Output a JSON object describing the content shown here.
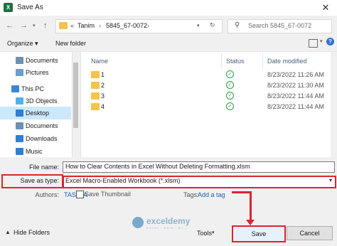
{
  "window": {
    "title": "Save As",
    "app_icon_letter": "X"
  },
  "nav": {
    "back": "←",
    "forward": "→",
    "up": "↑",
    "breadcrumb": [
      "Tanim",
      "5845_67-0072"
    ],
    "crumb_prefix": "«",
    "search_placeholder": "Search 5845_67-0072"
  },
  "toolbar": {
    "organize": "Organize ▾",
    "new_folder": "New folder"
  },
  "sidebar": {
    "items": [
      {
        "label": "Documents",
        "icon": "documents-icon",
        "color": "#6f8fb3"
      },
      {
        "label": "Pictures",
        "icon": "pictures-icon",
        "color": "#6a9fd4"
      },
      {
        "label": "This PC",
        "icon": "computer-icon",
        "color": "#3a86d6"
      },
      {
        "label": "3D Objects",
        "icon": "3d-objects-icon",
        "color": "#4fb3e8"
      },
      {
        "label": "Desktop",
        "icon": "desktop-icon",
        "color": "#2f7ed8"
      },
      {
        "label": "Documents",
        "icon": "documents-icon",
        "color": "#6f8fb3"
      },
      {
        "label": "Downloads",
        "icon": "downloads-icon",
        "color": "#2f7ed8"
      },
      {
        "label": "Music",
        "icon": "music-icon",
        "color": "#2f7ed8"
      }
    ]
  },
  "filelist": {
    "columns": {
      "name": "Name",
      "status": "Status",
      "date": "Date modified"
    },
    "rows": [
      {
        "name": "1",
        "status": "✓",
        "date": "8/23/2022 11:26 AM"
      },
      {
        "name": "2",
        "status": "✓",
        "date": "8/23/2022 11:30 AM"
      },
      {
        "name": "3",
        "status": "✓",
        "date": "8/23/2022 11:44 AM"
      },
      {
        "name": "4",
        "status": "✓",
        "date": "8/23/2022 11:44 AM"
      }
    ]
  },
  "form": {
    "file_name_label": "File name:",
    "file_name_value": "How to Clear Contents in Excel Without Deleting Formatting.xlsm",
    "save_type_label": "Save as type:",
    "save_type_value": "Excel Macro-Enabled Workbook (*.xlsm)",
    "authors_label": "Authors:",
    "authors_value": "TASATA",
    "tags_label": "Tags:",
    "tags_value": "Add a tag",
    "thumbnail_label": "Save Thumbnail",
    "hide_folders": "Hide Folders",
    "tools": "Tools",
    "save": "Save",
    "cancel": "Cancel"
  },
  "watermark": {
    "name": "exceldemy",
    "sub": "EXCEL · DATA · BI"
  },
  "colors": {
    "highlight": "#d9262e",
    "selected": "#cce8ff",
    "folder": "#f5c24c",
    "link": "#1a5fb4"
  }
}
